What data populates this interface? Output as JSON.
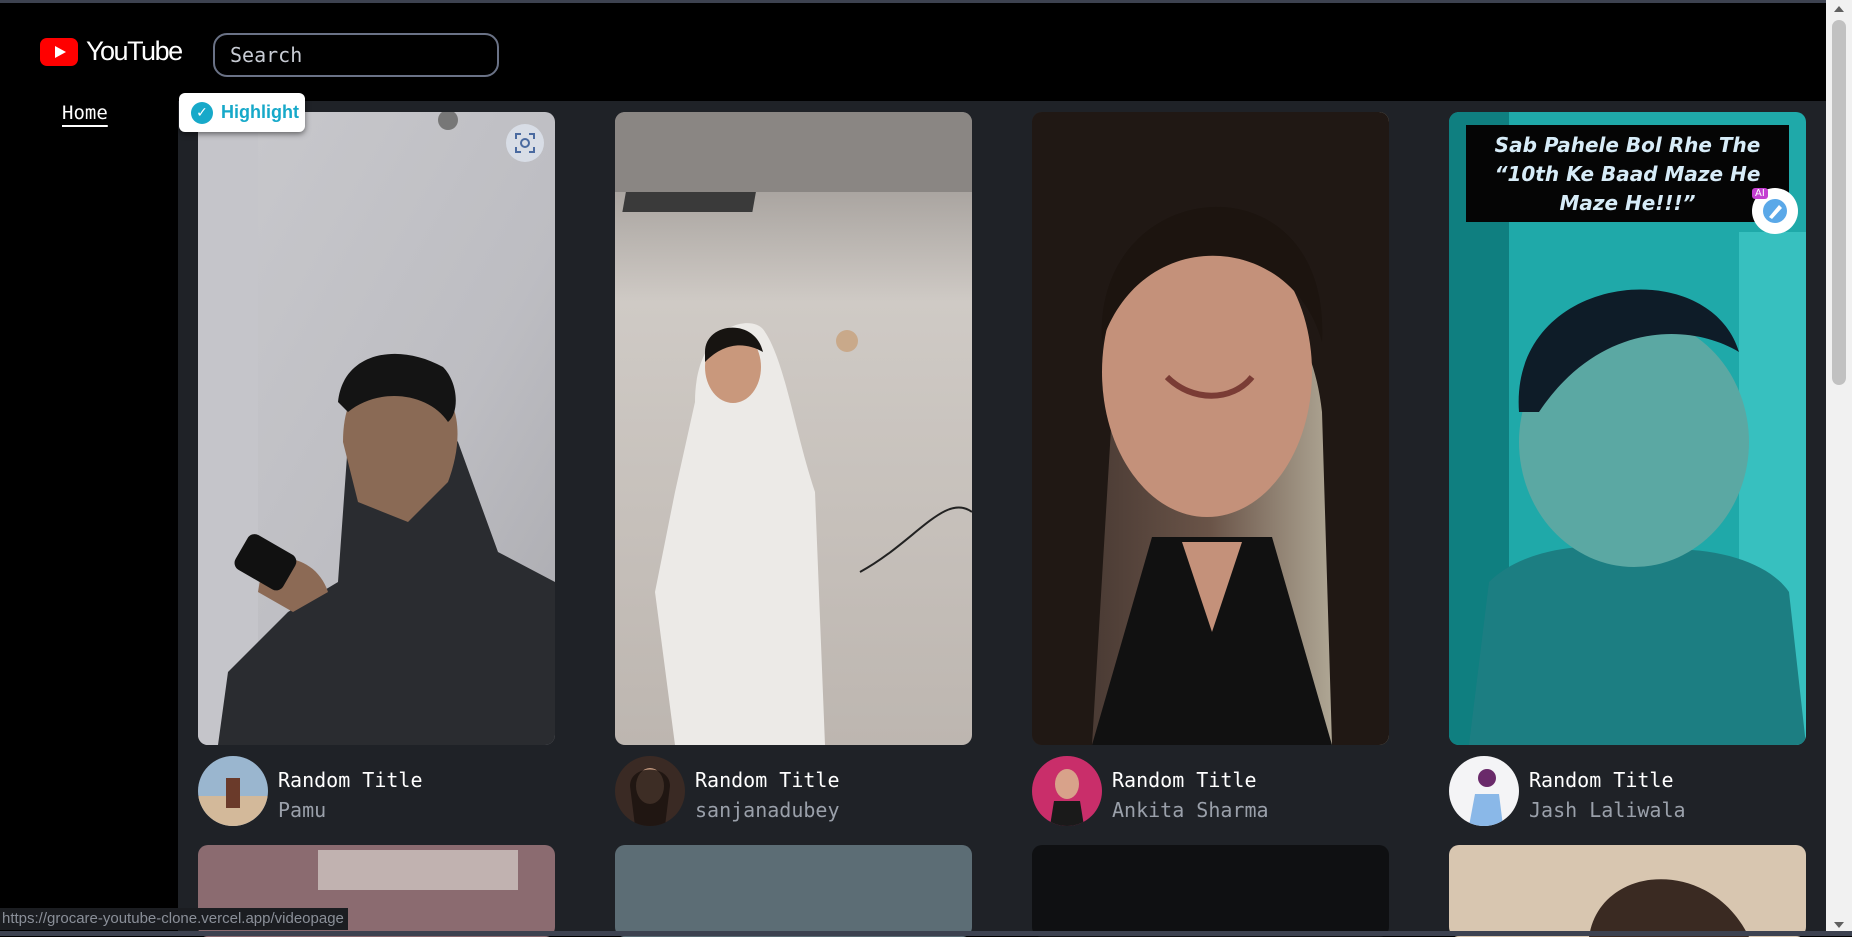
{
  "app": {
    "logo_text": "YouTube",
    "logo_color": "#ff0000"
  },
  "search": {
    "placeholder": "Search",
    "value": ""
  },
  "sidebar": {
    "items": [
      {
        "label": "Home",
        "active": true
      }
    ]
  },
  "toolbar": {
    "highlight_label": "Highlight",
    "highlight_color": "#17a9c9"
  },
  "videos": [
    {
      "title": "Random Title",
      "channel": "Pamu"
    },
    {
      "title": "Random Title",
      "channel": "sanjanadubey"
    },
    {
      "title": "Random Title",
      "channel": "Ankita Sharma"
    },
    {
      "title": "Random Title",
      "channel": "Jash Laliwala",
      "caption": "Sab Pahele Bol Rhe The “10th Ke Baad Maze He Maze He!!!”",
      "ai_badge": "AI"
    }
  ],
  "status_bar": {
    "url": "https://grocare-youtube-clone.vercel.app/videopage"
  }
}
